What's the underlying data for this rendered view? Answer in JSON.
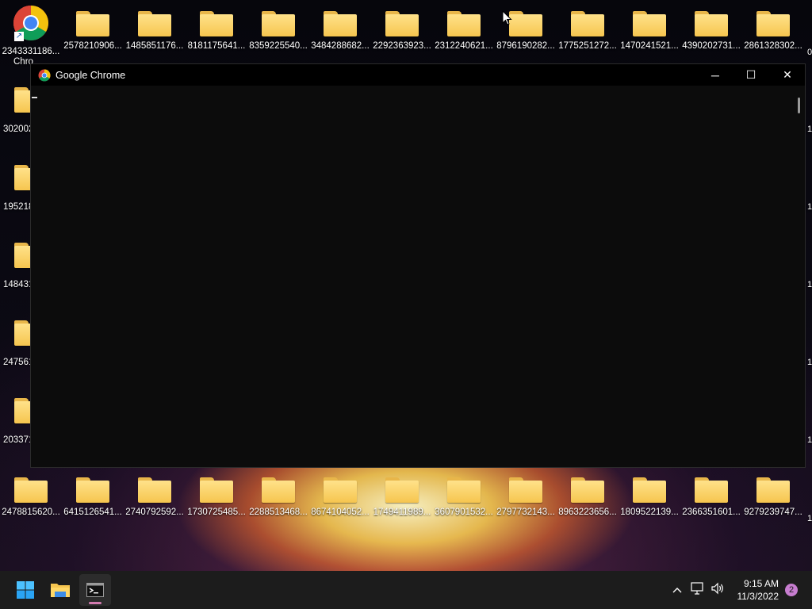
{
  "desktop": {
    "chrome_shortcut": {
      "label_overlap": "2343331186...",
      "label_line2": "Chro"
    },
    "top_row": [
      "2578210906...",
      "1485851176...",
      "8181175641...",
      "8359225540...",
      "3484288682...",
      "2292363923...",
      "2312240621...",
      "8796190282...",
      "1775251272...",
      "1470241521...",
      "4390202731...",
      "2861328302..."
    ],
    "top_row_edge": "0",
    "left_column": [
      "302002",
      "195218",
      "148431",
      "247561",
      "203371"
    ],
    "right_edge_labels": [
      "1",
      "1",
      "1",
      "1",
      "1"
    ],
    "bottom_row": [
      "2478815620...",
      "6415126541...",
      "2740792592...",
      "1730725485...",
      "2288513468...",
      "8674104052...",
      "1749411989...",
      "3607901532...",
      "2797732143...",
      "8963223656...",
      "1809522139...",
      "2366351601...",
      "9279239747..."
    ],
    "bottom_row_edge": "1"
  },
  "window": {
    "title": "Google Chrome",
    "minimize": "─",
    "maximize": "☐",
    "close": "✕"
  },
  "taskbar": {
    "time": "9:15 AM",
    "date": "11/3/2022",
    "notifications": "2",
    "icons": [
      "start-icon",
      "file-explorer-icon",
      "terminal-icon"
    ]
  },
  "colors": {
    "window_bg": "#0c0c0c",
    "taskbar_bg": "#1c1c1c",
    "folder": "#f6c54f",
    "accent": "#c77dcf"
  }
}
